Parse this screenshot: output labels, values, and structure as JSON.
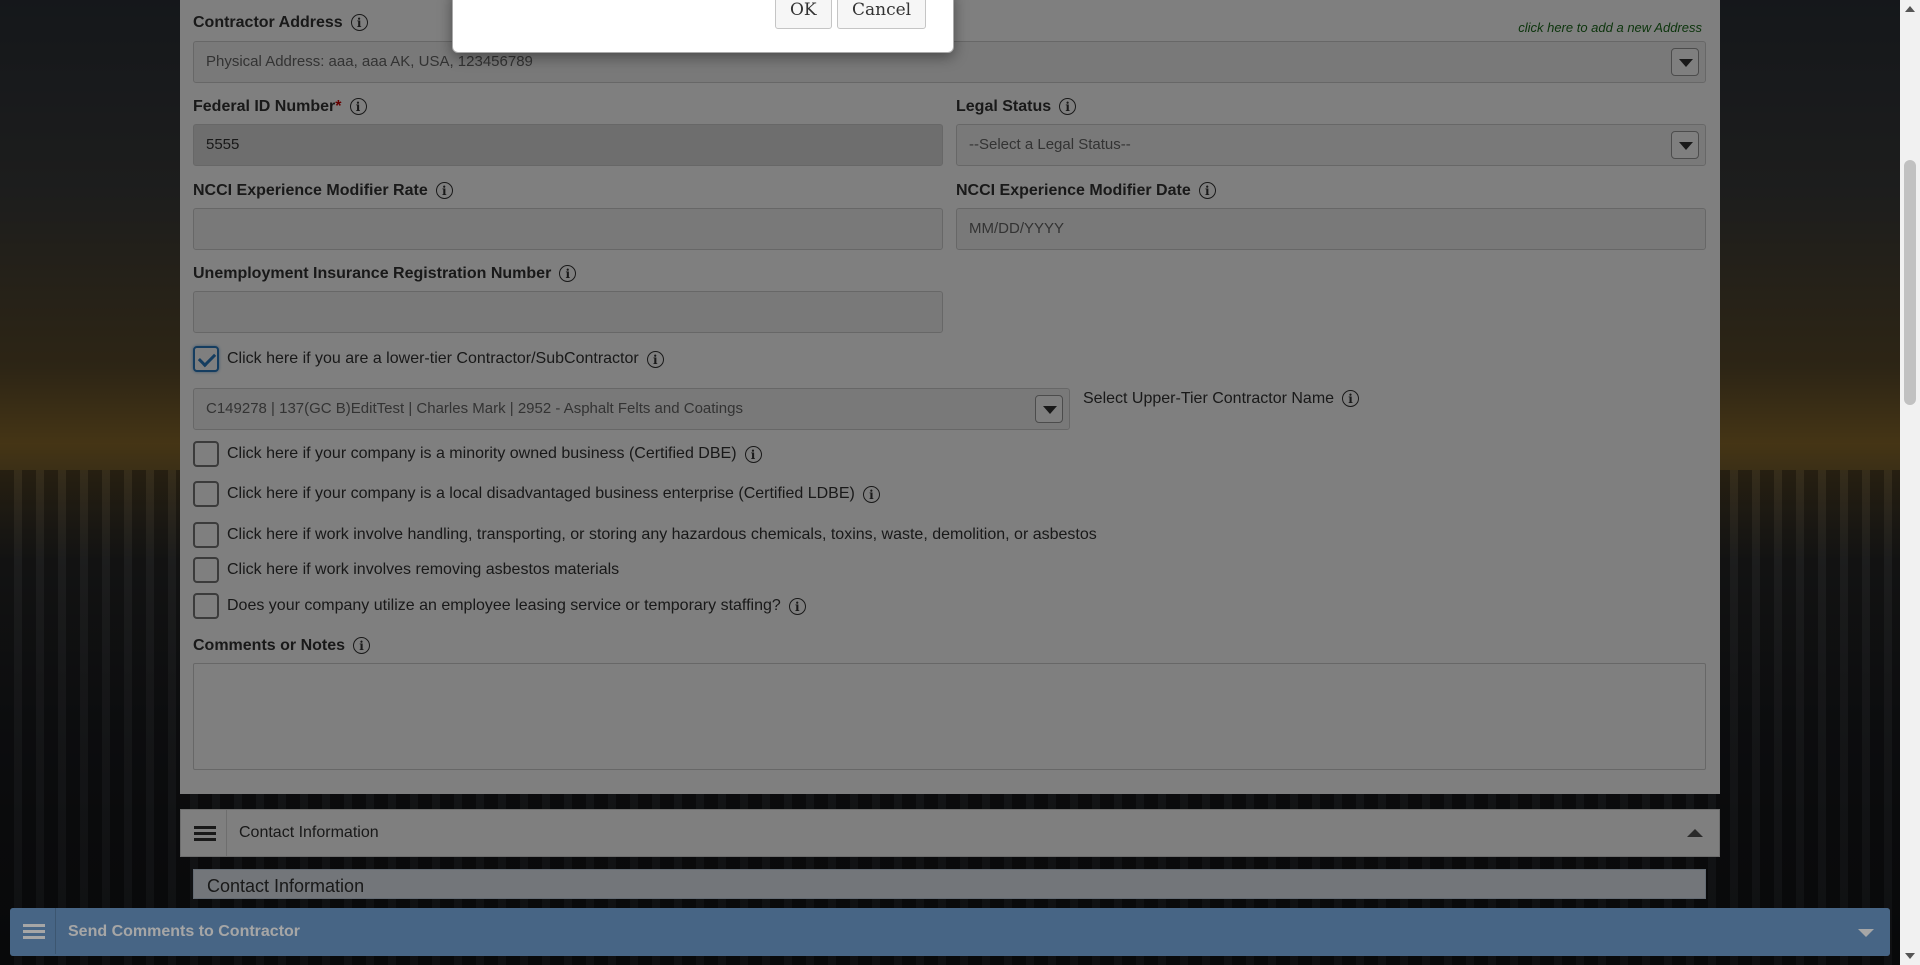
{
  "address": {
    "label": "Contractor Address",
    "add_link": "click here to add a new Address",
    "value": "Physical Address: aaa, aaa AK, USA, 123456789"
  },
  "federal_id": {
    "label": "Federal ID Number",
    "required_mark": "*",
    "value": "5555"
  },
  "legal_status": {
    "label": "Legal Status",
    "value": "--Select a Legal Status--"
  },
  "ncci_rate": {
    "label": "NCCI Experience Modifier Rate",
    "value": ""
  },
  "ncci_date": {
    "label": "NCCI Experience Modifier Date",
    "placeholder": "MM/DD/YYYY"
  },
  "unemployment": {
    "label": "Unemployment Insurance Registration Number",
    "value": ""
  },
  "lower_tier": {
    "label": "Click here if you are a lower-tier Contractor/SubContractor",
    "checked": true
  },
  "upper_tier": {
    "value": "C149278 | 137(GC B)EditTest | Charles Mark | 2952 - Asphalt Felts and Coatings",
    "label": "Select Upper-Tier Contractor Name"
  },
  "checkboxes": {
    "dbe": "Click here if your company is a minority owned business (Certified DBE)",
    "ldbe": "Click here if your company is a local disadvantaged business enterprise (Certified LDBE)",
    "hazardous": "Click here if work involve handling, transporting, or storing any hazardous chemicals, toxins, waste, demolition, or asbestos",
    "asbestos": "Click here if work involves removing asbestos materials",
    "leasing": "Does your company utilize an employee leasing service or temporary staffing?"
  },
  "comments": {
    "label": "Comments or Notes"
  },
  "contact_section": {
    "title": "Contact Information",
    "subheading": "Contact Information"
  },
  "footer": {
    "title": "Send Comments to Contractor"
  },
  "dialog": {
    "ok_label": "OK",
    "cancel_label": "Cancel"
  },
  "colors": {
    "footer": "#6d9ccc",
    "link": "#1a6a1a",
    "overlay": "rgba(0,0,0,0.5)"
  },
  "icons": [
    "info-icon",
    "dropdown-caret-icon",
    "hamburger-icon",
    "chevron-up-icon",
    "chevron-down-icon",
    "checkmark-icon"
  ]
}
